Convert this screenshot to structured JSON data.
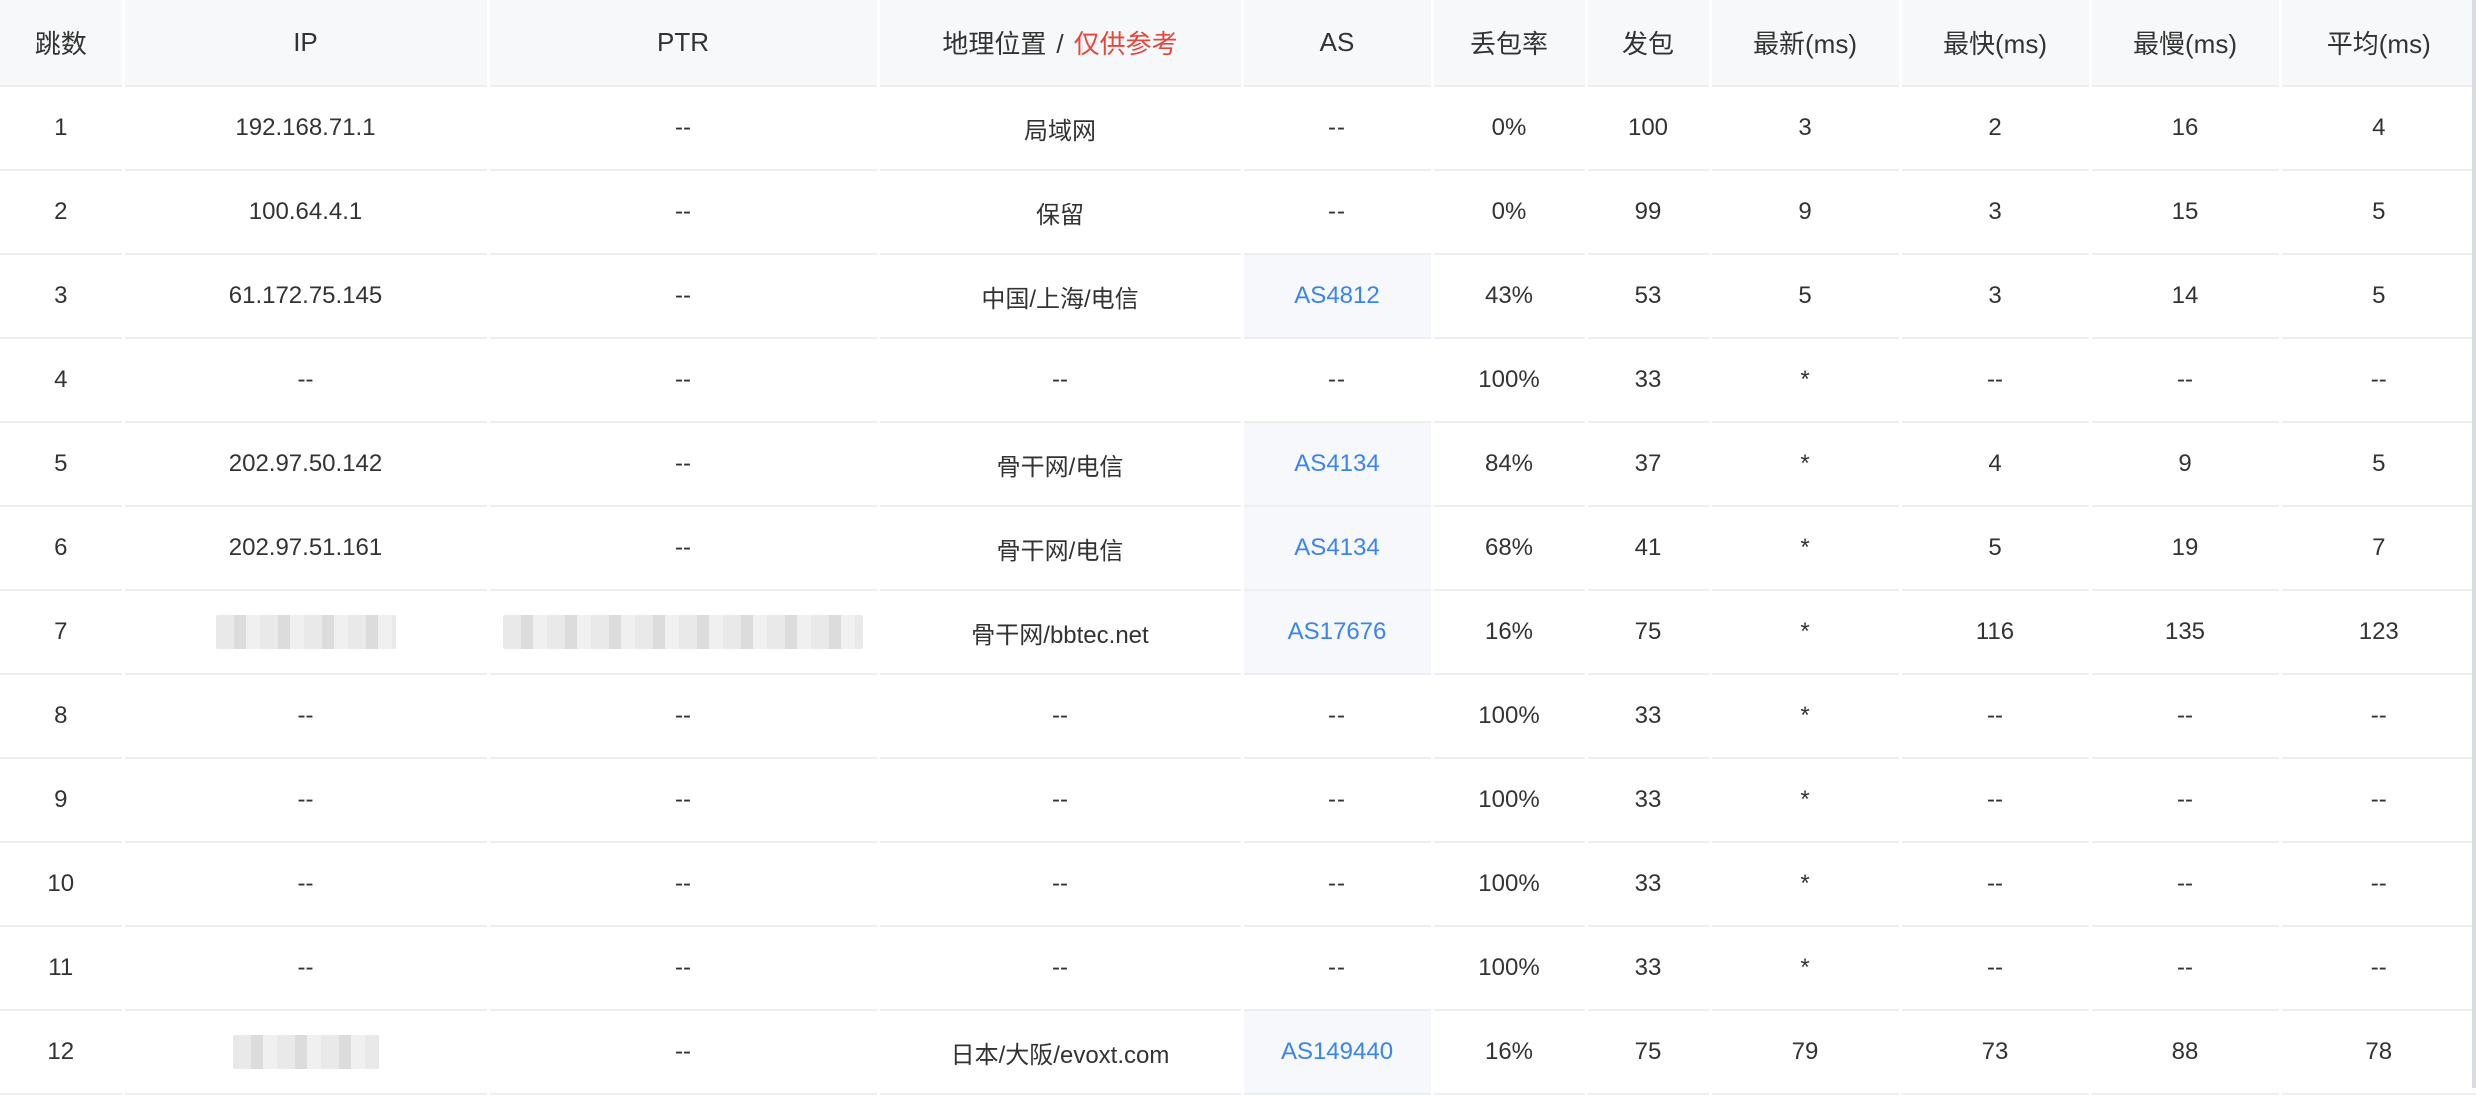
{
  "columns": {
    "hop": "跳数",
    "ip": "IP",
    "ptr": "PTR",
    "geo_main": "地理位置",
    "geo_sep": "/",
    "geo_ref": "仅供参考",
    "as": "AS",
    "loss": "丢包率",
    "sent": "发包",
    "last": "最新(ms)",
    "best": "最快(ms)",
    "worst": "最慢(ms)",
    "avg": "平均(ms)"
  },
  "colors": {
    "geo_ref": "#e8453c",
    "as_link": "#3a83f3",
    "header_bg": "#f7f8fa"
  },
  "rows": [
    {
      "hop": "1",
      "ip": "192.168.71.1",
      "ptr": "--",
      "geo": "局域网",
      "as": "--",
      "loss": "0%",
      "sent": "100",
      "last": "3",
      "best": "2",
      "worst": "16",
      "avg": "4"
    },
    {
      "hop": "2",
      "ip": "100.64.4.1",
      "ptr": "--",
      "geo": "保留",
      "as": "--",
      "loss": "0%",
      "sent": "99",
      "last": "9",
      "best": "3",
      "worst": "15",
      "avg": "5"
    },
    {
      "hop": "3",
      "ip": "61.172.75.145",
      "ptr": "--",
      "geo": "中国/上海/电信",
      "as": "AS4812",
      "loss": "43%",
      "sent": "53",
      "last": "5",
      "best": "3",
      "worst": "14",
      "avg": "5"
    },
    {
      "hop": "4",
      "ip": "--",
      "ptr": "--",
      "geo": "--",
      "as": "--",
      "loss": "100%",
      "sent": "33",
      "last": "*",
      "best": "--",
      "worst": "--",
      "avg": "--"
    },
    {
      "hop": "5",
      "ip": "202.97.50.142",
      "ptr": "--",
      "geo": "骨干网/电信",
      "as": "AS4134",
      "loss": "84%",
      "sent": "37",
      "last": "*",
      "best": "4",
      "worst": "9",
      "avg": "5"
    },
    {
      "hop": "6",
      "ip": "202.97.51.161",
      "ptr": "--",
      "geo": "骨干网/电信",
      "as": "AS4134",
      "loss": "68%",
      "sent": "41",
      "last": "*",
      "best": "5",
      "worst": "19",
      "avg": "7"
    },
    {
      "hop": "7",
      "ip": "",
      "ptr": "",
      "geo": "骨干网/bbtec.net",
      "as": "AS17676",
      "loss": "16%",
      "sent": "75",
      "last": "*",
      "best": "116",
      "worst": "135",
      "avg": "123"
    },
    {
      "hop": "8",
      "ip": "--",
      "ptr": "--",
      "geo": "--",
      "as": "--",
      "loss": "100%",
      "sent": "33",
      "last": "*",
      "best": "--",
      "worst": "--",
      "avg": "--"
    },
    {
      "hop": "9",
      "ip": "--",
      "ptr": "--",
      "geo": "--",
      "as": "--",
      "loss": "100%",
      "sent": "33",
      "last": "*",
      "best": "--",
      "worst": "--",
      "avg": "--"
    },
    {
      "hop": "10",
      "ip": "--",
      "ptr": "--",
      "geo": "--",
      "as": "--",
      "loss": "100%",
      "sent": "33",
      "last": "*",
      "best": "--",
      "worst": "--",
      "avg": "--"
    },
    {
      "hop": "11",
      "ip": "--",
      "ptr": "--",
      "geo": "--",
      "as": "--",
      "loss": "100%",
      "sent": "33",
      "last": "*",
      "best": "--",
      "worst": "--",
      "avg": "--"
    },
    {
      "hop": "12",
      "ip": "",
      "ptr": "--",
      "geo": "日本/大阪/evoxt.com",
      "as": "AS149440",
      "loss": "16%",
      "sent": "75",
      "last": "79",
      "best": "73",
      "worst": "88",
      "avg": "78"
    }
  ]
}
